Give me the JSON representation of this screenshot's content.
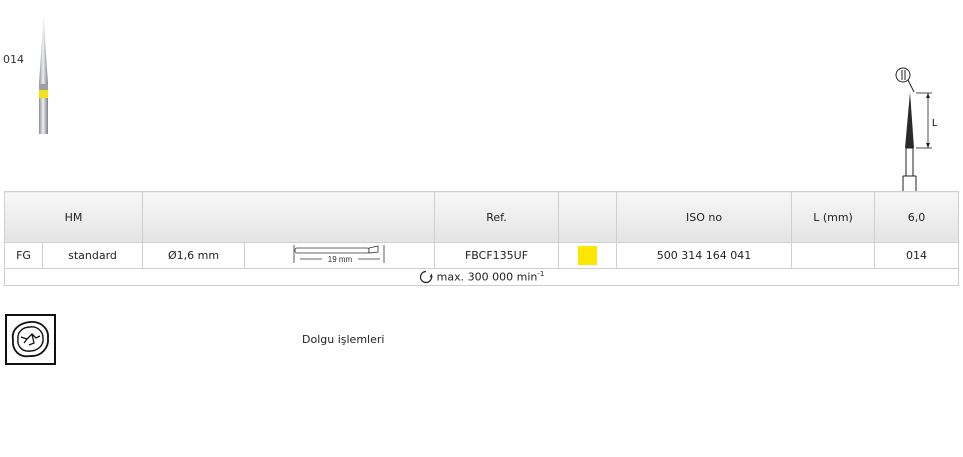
{
  "product": {
    "size_code": "014"
  },
  "diagram": {
    "dimension_label": "L"
  },
  "table": {
    "headers": {
      "material": "HM",
      "blank": "",
      "ref": "Ref.",
      "color": "",
      "iso": "ISO no",
      "length": "L (mm)",
      "length_value": "6,0"
    },
    "row": {
      "shank": "FG",
      "type": "standard",
      "diameter": "Ø1,6 mm",
      "shank_length": "19 mm",
      "ref": "FBCF135UF",
      "color_hex": "#ffe600",
      "iso": "500 314 164 041",
      "length": "",
      "size": "014"
    },
    "speed": {
      "text": "max. 300 000 min",
      "unit_sup": "-1"
    }
  },
  "application": {
    "icon": "filling-icon",
    "label": "Dolgu işlemleri"
  }
}
